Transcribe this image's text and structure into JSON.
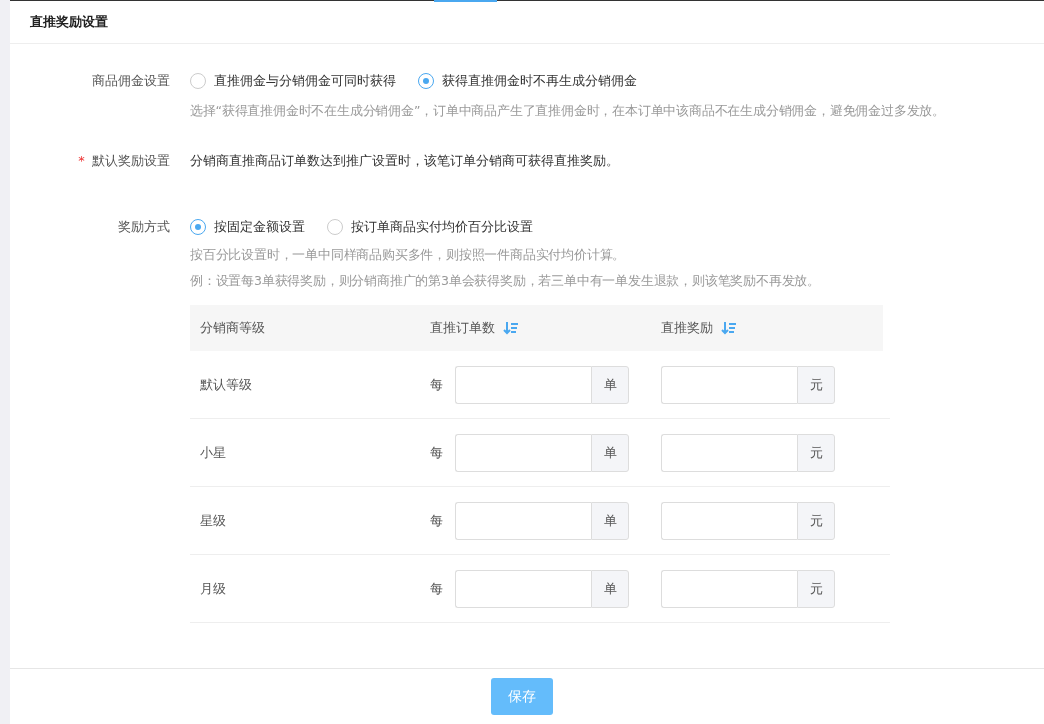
{
  "header": {
    "title": "直推奖励设置"
  },
  "commission": {
    "label": "商品佣金设置",
    "options": [
      {
        "label": "直推佣金与分销佣金可同时获得",
        "selected": false
      },
      {
        "label": "获得直推佣金时不再生成分销佣金",
        "selected": true
      }
    ],
    "hint": "选择“获得直推佣金时不在生成分销佣金”，订单中商品产生了直推佣金时，在本订单中该商品不在生成分销佣金，避免佣金过多发放。"
  },
  "default_reward": {
    "label": "默认奖励设置",
    "required_mark": "*",
    "text": "分销商直推商品订单数达到推广设置时，该笔订单分销商可获得直推奖励。"
  },
  "reward_method": {
    "label": "奖励方式",
    "options": [
      {
        "label": "按固定金额设置",
        "selected": true
      },
      {
        "label": "按订单商品实付均价百分比设置",
        "selected": false
      }
    ],
    "hints": [
      "按百分比设置时，一单中同样商品购买多件，则按照一件商品实付均价计算。",
      "例：设置每3单获得奖励，则分销商推广的第3单会获得奖励，若三单中有一单发生退款，则该笔奖励不再发放。"
    ]
  },
  "table": {
    "columns": [
      {
        "label": "分销商等级",
        "sortable": false
      },
      {
        "label": "直推订单数",
        "sortable": true
      },
      {
        "label": "直推奖励",
        "sortable": true
      }
    ],
    "rows": [
      {
        "level": "默认等级",
        "prefix": "每",
        "order_unit": "单",
        "reward_unit": "元"
      },
      {
        "level": "小星",
        "prefix": "每",
        "order_unit": "单",
        "reward_unit": "元"
      },
      {
        "level": "星级",
        "prefix": "每",
        "order_unit": "单",
        "reward_unit": "元"
      },
      {
        "level": "月级",
        "prefix": "每",
        "order_unit": "单",
        "reward_unit": "元"
      }
    ]
  },
  "save_button": "保存"
}
